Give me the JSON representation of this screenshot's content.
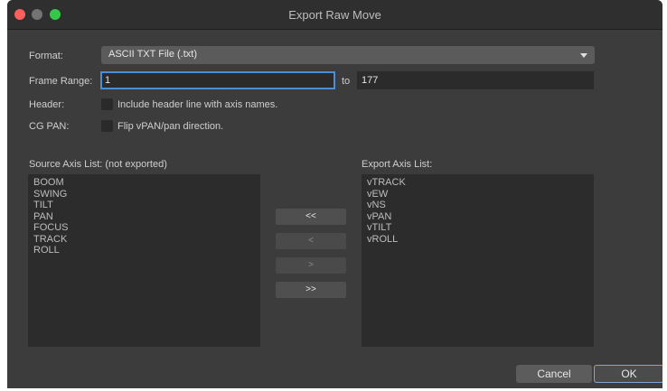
{
  "window": {
    "title": "Export Raw Move"
  },
  "form": {
    "format_label": "Format:",
    "format_value": "ASCII TXT File (.txt)",
    "frame_range_label": "Frame Range:",
    "frame_start": "1",
    "to_label": "to",
    "frame_end": "177",
    "header_label": "Header:",
    "header_checkbox_label": "Include header line with axis names.",
    "cgpan_label": "CG PAN:",
    "cgpan_checkbox_label": "Flip vPAN/pan direction."
  },
  "source": {
    "label": "Source Axis List: (not exported)",
    "items": [
      "BOOM",
      "SWING",
      "TILT",
      "PAN",
      "FOCUS",
      "TRACK",
      "ROLL"
    ]
  },
  "export": {
    "label": "Export Axis List:",
    "items": [
      "vTRACK",
      "vEW",
      "vNS",
      "vPAN",
      "vTILT",
      "vROLL"
    ]
  },
  "move_buttons": {
    "all_left": "<<",
    "left": "<",
    "right": ">",
    "all_right": ">>"
  },
  "buttons": {
    "cancel": "Cancel",
    "ok": "OK"
  }
}
